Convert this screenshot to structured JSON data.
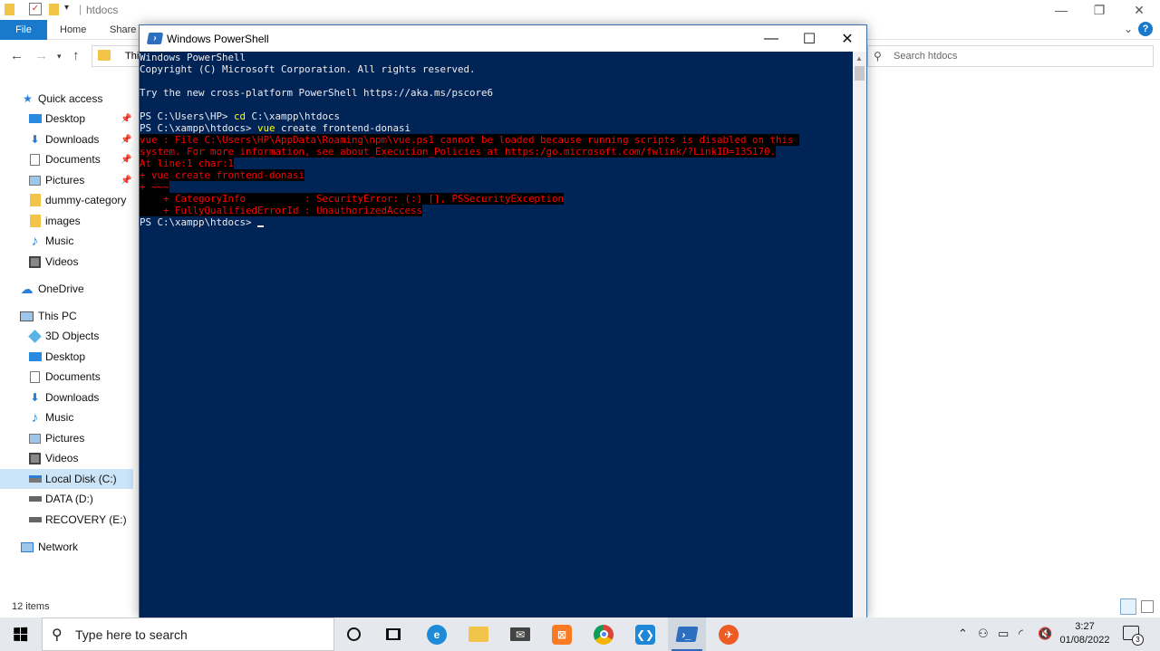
{
  "explorer": {
    "title": "htdocs",
    "ribbon_tabs": [
      "File",
      "Home",
      "Share"
    ],
    "address_text": "Thi",
    "search_placeholder": "Search htdocs",
    "status_text": "12 items",
    "nav": {
      "quick_access": "Quick access",
      "quick_items": [
        "Desktop",
        "Downloads",
        "Documents",
        "Pictures",
        "dummy-category",
        "images",
        "Music",
        "Videos"
      ],
      "onedrive": "OneDrive",
      "this_pc": "This PC",
      "pc_items": [
        "3D Objects",
        "Desktop",
        "Documents",
        "Downloads",
        "Music",
        "Pictures",
        "Videos",
        "Local Disk (C:)",
        "DATA (D:)",
        "RECOVERY (E:)"
      ],
      "network": "Network"
    }
  },
  "powershell": {
    "title": "Windows PowerShell",
    "lines": {
      "l1": "Windows PowerShell",
      "l2": "Copyright (C) Microsoft Corporation. All rights reserved.",
      "l3": "Try the new cross-platform PowerShell https://aka.ms/pscore6",
      "p1_prompt": "PS C:\\Users\\HP> ",
      "p1_cmd": "cd",
      "p1_args": " C:\\xampp\\htdocs",
      "p2_prompt": "PS C:\\xampp\\htdocs> ",
      "p2_cmd": "vue",
      "p2_args": " create frontend-donasi",
      "e1": "vue : File C:\\Users\\HP\\AppData\\Roaming\\npm\\vue.ps1 cannot be loaded because running scripts is disabled on this ",
      "e2": "system. For more information, see about_Execution_Policies at https:/go.microsoft.com/fwlink/?LinkID=135170.",
      "e3": "At line:1 char:1",
      "e4": "+ vue create frontend-donasi",
      "e5": "+ ~~~",
      "e6": "    + CategoryInfo          : SecurityError: (:) [], PSSecurityException",
      "e7": "    + FullyQualifiedErrorId : UnauthorizedAccess",
      "p3_prompt": "PS C:\\xampp\\htdocs> "
    }
  },
  "taskbar": {
    "search_placeholder": "Type here to search",
    "time": "3:27",
    "date": "01/08/2022",
    "notification_count": "3"
  },
  "colors": {
    "console_bg": "#012456",
    "console_text": "#eeedf0",
    "command_highlight": "#ffff00",
    "error_text": "#ff0000",
    "accent": "#1979ca"
  }
}
